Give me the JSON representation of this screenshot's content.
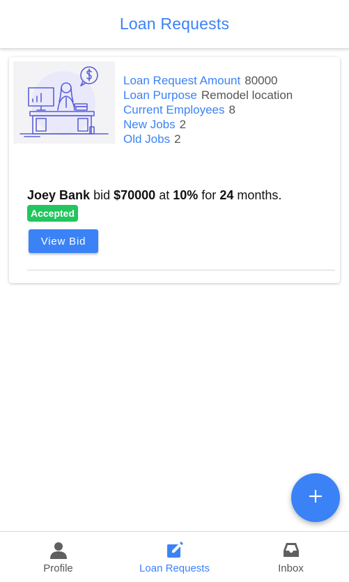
{
  "header": {
    "title": "Loan Requests"
  },
  "loan_request": {
    "details": [
      {
        "label": "Loan Request Amount",
        "value": "80000"
      },
      {
        "label": "Loan Purpose",
        "value": "Remodel location"
      },
      {
        "label": "Current Employees",
        "value": "8"
      },
      {
        "label": "New Jobs",
        "value": "2"
      },
      {
        "label": "Old Jobs",
        "value": "2"
      }
    ],
    "bid": {
      "bidder": "Joey Bank",
      "word_bid": "bid",
      "amount": "$70000",
      "word_at": "at",
      "rate": "10%",
      "word_for": "for",
      "term": "24",
      "word_months": "months."
    },
    "status_badge": "Accepted",
    "view_bid_label": "View Bid"
  },
  "fab": {
    "icon": "plus-icon"
  },
  "bottom_nav": {
    "items": [
      {
        "label": "Profile",
        "icon": "person-icon"
      },
      {
        "label": "Loan Requests",
        "icon": "edit-icon"
      },
      {
        "label": "Inbox",
        "icon": "inbox-icon"
      }
    ],
    "active_color": "#3b82f6"
  },
  "colors": {
    "accent": "#3b82f6",
    "success": "#22c55e"
  }
}
